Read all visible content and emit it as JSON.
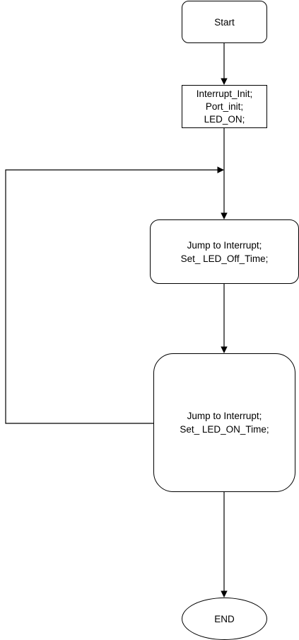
{
  "diagram": {
    "nodes": {
      "start": {
        "label": "Start"
      },
      "init": {
        "label": "Interrupt_Init;\nPort_init;\nLED_ON;"
      },
      "led_off": {
        "label": "Jump to Interrupt;\nSet_ LED_Off_Time;"
      },
      "led_on": {
        "label": "Jump to Interrupt;\nSet_ LED_ON_Time;"
      },
      "end": {
        "label": "END"
      }
    },
    "edges": [
      {
        "from": "start",
        "to": "init"
      },
      {
        "from": "init",
        "to": "led_off"
      },
      {
        "from": "led_off",
        "to": "led_on"
      },
      {
        "from": "led_on",
        "to": "end"
      },
      {
        "from": "led_on",
        "to": "led_off",
        "kind": "loop-back"
      }
    ],
    "colors": {
      "stroke": "#000000",
      "fill": "#ffffff",
      "text": "#000000"
    }
  }
}
